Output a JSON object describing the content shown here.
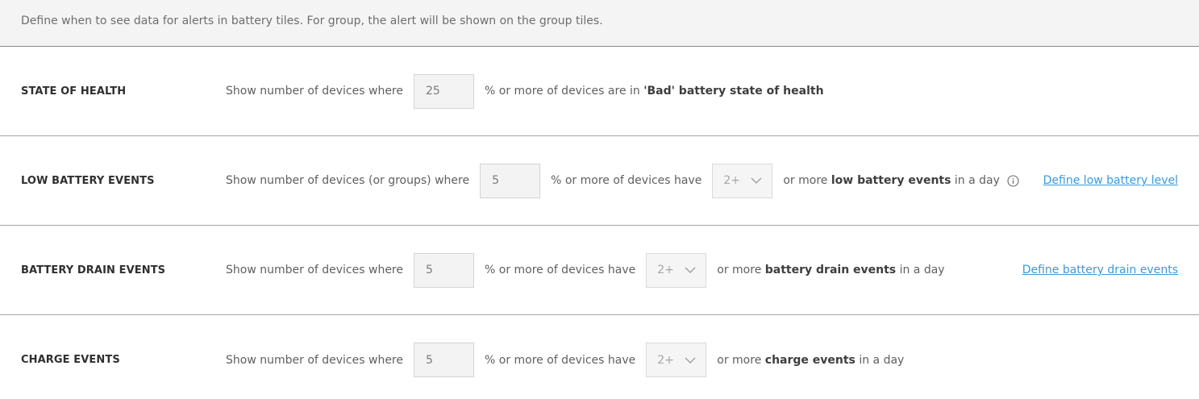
{
  "header": {
    "description": "Define when to see data for alerts in battery tiles. For group, the alert will be shown on the group tiles."
  },
  "rows": [
    {
      "label": "STATE OF HEALTH",
      "prefix": "Show number of devices where",
      "input_value": "25",
      "text_before": "% or more of devices are in ",
      "bold": "'Bad' battery state of health"
    },
    {
      "label": "LOW BATTERY EVENTS",
      "prefix": "Show number of devices (or groups) where",
      "input_value": "5",
      "text_after_input": "% or more of devices have",
      "select_value": "2+",
      "text_before": "or more ",
      "bold": "low battery events",
      "text_after": " in a day",
      "link": "Define low battery level"
    },
    {
      "label": "BATTERY DRAIN EVENTS",
      "prefix": "Show number of devices where",
      "input_value": "5",
      "text_after_input": "% or more of devices have",
      "select_value": "2+",
      "text_before": "or more ",
      "bold": "battery drain events",
      "text_after": " in a day",
      "link": "Define battery drain events"
    },
    {
      "label": "CHARGE EVENTS",
      "prefix": "Show number of devices where",
      "input_value": "5",
      "text_after_input": "% or more of devices have",
      "select_value": "2+",
      "text_before": "or more ",
      "bold": "charge events",
      "text_after": " in a day"
    }
  ],
  "icons": {
    "info": "info-icon",
    "chevron": "chevron-down-icon"
  },
  "colors": {
    "link": "#3a9ad9",
    "header_bg": "#f4f4f4"
  }
}
